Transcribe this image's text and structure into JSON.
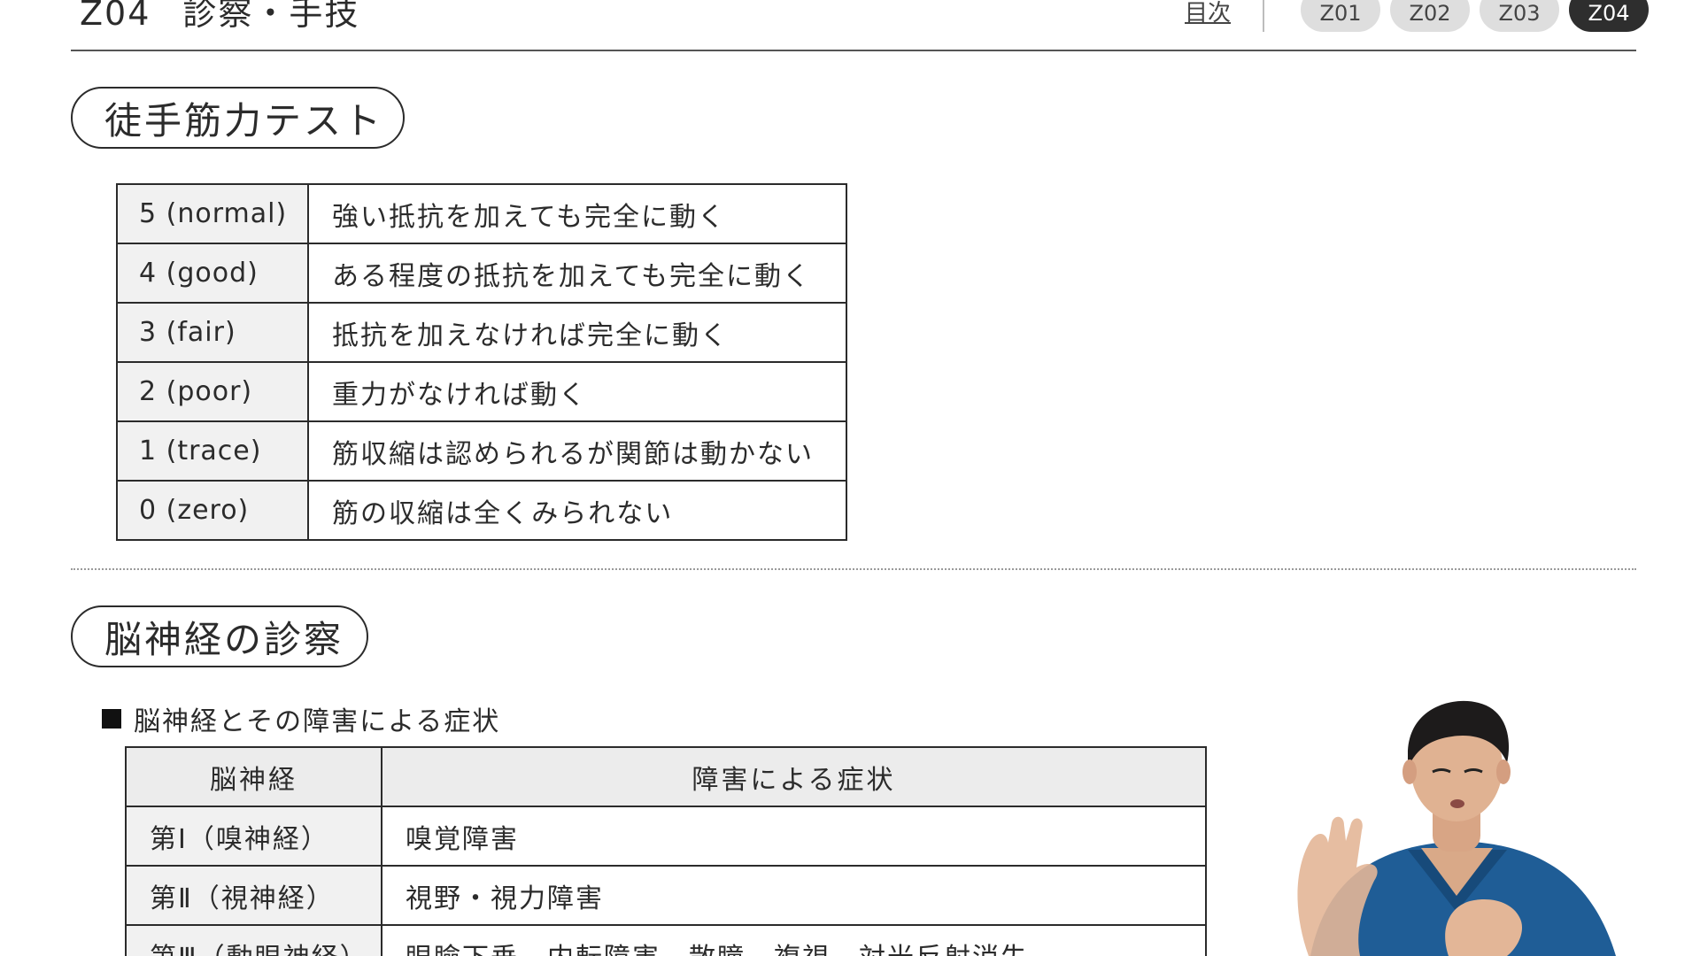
{
  "header": {
    "code": "Z04",
    "title": "診察・手技",
    "toc_link": "目次",
    "chapters": [
      {
        "label": "Z01",
        "active": false
      },
      {
        "label": "Z02",
        "active": false
      },
      {
        "label": "Z03",
        "active": false
      },
      {
        "label": "Z04",
        "active": true
      }
    ]
  },
  "mmt": {
    "heading": "徒手筋力テスト",
    "rows": [
      {
        "grade": "5 (normal)",
        "desc": "強い抵抗を加えても完全に動く"
      },
      {
        "grade": "4 (good)",
        "desc": "ある程度の抵抗を加えても完全に動く"
      },
      {
        "grade": "3 (fair)",
        "desc": "抵抗を加えなければ完全に動く"
      },
      {
        "grade": "2 (poor)",
        "desc": "重力がなければ動く"
      },
      {
        "grade": "1 (trace)",
        "desc": "筋収縮は認められるが関節は動かない"
      },
      {
        "grade": "0 (zero)",
        "desc": "筋の収縮は全くみられない"
      }
    ]
  },
  "cranial": {
    "heading": "脳神経の診察",
    "subheading": "脳神経とその障害による症状",
    "columns": [
      "脳神経",
      "障害による症状"
    ],
    "rows": [
      {
        "nerve": "第Ⅰ（嗅神経）",
        "symptom": "嗅覚障害"
      },
      {
        "nerve": "第Ⅱ（視神経）",
        "symptom": "視野・視力障害"
      },
      {
        "nerve": "第Ⅲ（動眼神経）",
        "symptom": "眼瞼下垂、内転障害、散瞳、複視、対光反射消失"
      }
    ]
  }
}
